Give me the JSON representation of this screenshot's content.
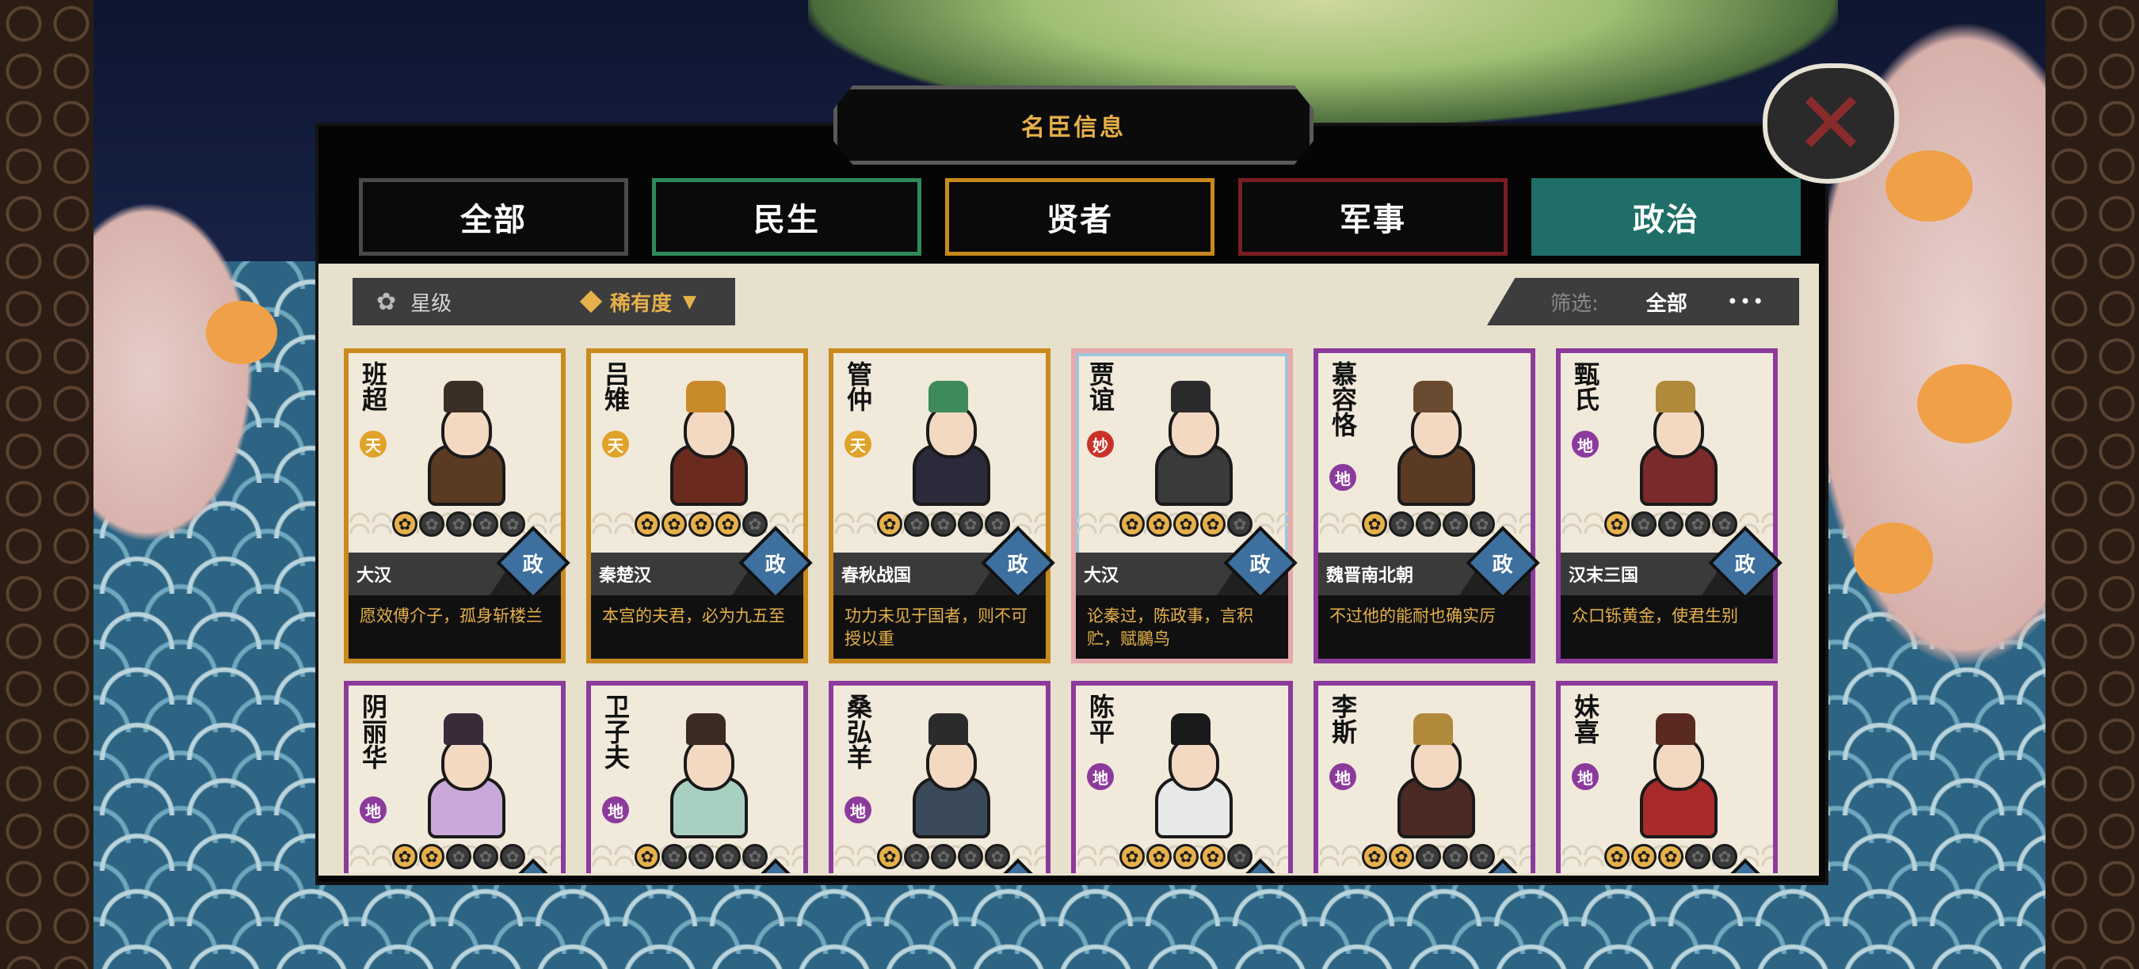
{
  "panel": {
    "title": "名臣信息"
  },
  "tabs": [
    {
      "label": "全部",
      "border": "#4a4a4a",
      "bg": "#0a0a0a",
      "active": false
    },
    {
      "label": "民生",
      "border": "#2f8a5a",
      "bg": "#0a0a0a",
      "active": false
    },
    {
      "label": "贤者",
      "border": "#c88a1e",
      "bg": "#0a0a0a",
      "active": false
    },
    {
      "label": "军事",
      "border": "#7a1e22",
      "bg": "#0a0a0a",
      "active": false
    },
    {
      "label": "政治",
      "border": "#1f6f68",
      "bg": "#1f6f68",
      "active": true
    }
  ],
  "sort": {
    "star_label": "星级",
    "rarity_label": "稀有度"
  },
  "filter": {
    "label": "筛选:",
    "value": "全部",
    "more": "•••"
  },
  "colors": {
    "rank_tian": "#e0a32a",
    "rank_miao": "#c8322a",
    "rank_di": "#8c3a9c",
    "type_zheng": "#3d6f9f",
    "accent_gold": "#e6b04a"
  },
  "cards": [
    {
      "name": "班超",
      "rank": "天",
      "rank_color": "#e0a32a",
      "stars": 1,
      "era": "大汉",
      "type": "政",
      "quote": "愿效傅介子，孤身斩楼兰",
      "frame": "gold",
      "hat": "#3b2e26",
      "robe": "#5a3a22"
    },
    {
      "name": "吕雉",
      "rank": "天",
      "rank_color": "#e0a32a",
      "stars": 4,
      "era": "秦楚汉",
      "type": "政",
      "quote": "本宫的夫君，必为九五至",
      "frame": "gold",
      "hat": "#c98a2a",
      "robe": "#6a2a1e"
    },
    {
      "name": "管仲",
      "rank": "天",
      "rank_color": "#e0a32a",
      "stars": 1,
      "era": "春秋战国",
      "type": "政",
      "quote": "功力未见于国者，则不可授以重",
      "frame": "gold",
      "hat": "#3f8a5a",
      "robe": "#2a2a3a"
    },
    {
      "name": "贾谊",
      "rank": "妙",
      "rank_color": "#c8322a",
      "stars": 4,
      "era": "大汉",
      "type": "政",
      "quote": "论秦过，陈政事，言积贮，赋鵩鸟",
      "frame": "pink",
      "hat": "#2b2b2b",
      "robe": "#3a3a3a"
    },
    {
      "name": "慕容恪",
      "rank": "地",
      "rank_color": "#8c3a9c",
      "stars": 1,
      "era": "魏晋南北朝",
      "type": "政",
      "quote": "不过他的能耐也确实厉",
      "frame": "purple",
      "hat": "#6a4a30",
      "robe": "#5a3a22"
    },
    {
      "name": "甄氏",
      "rank": "地",
      "rank_color": "#8c3a9c",
      "stars": 1,
      "era": "汉末三国",
      "type": "政",
      "quote": "众口铄黄金，使君生别",
      "frame": "purple",
      "hat": "#b08a3a",
      "robe": "#7a2a2a"
    },
    {
      "name": "阴丽华",
      "rank": "地",
      "rank_color": "#8c3a9c",
      "stars": 2,
      "era": "",
      "type": "政",
      "quote": "",
      "frame": "purple",
      "hat": "#3a2a3a",
      "robe": "#c8a8d8"
    },
    {
      "name": "卫子夫",
      "rank": "地",
      "rank_color": "#8c3a9c",
      "stars": 1,
      "era": "",
      "type": "政",
      "quote": "",
      "frame": "purple",
      "hat": "#3a2a22",
      "robe": "#a8d0c0"
    },
    {
      "name": "桑弘羊",
      "rank": "地",
      "rank_color": "#8c3a9c",
      "stars": 1,
      "era": "",
      "type": "政",
      "quote": "",
      "frame": "purple",
      "hat": "#2b2b2b",
      "robe": "#3a4a5a"
    },
    {
      "name": "陈平",
      "rank": "地",
      "rank_color": "#8c3a9c",
      "stars": 4,
      "era": "",
      "type": "政",
      "quote": "",
      "frame": "purple",
      "hat": "#1a1a1a",
      "robe": "#e8e8e8"
    },
    {
      "name": "李斯",
      "rank": "地",
      "rank_color": "#8c3a9c",
      "stars": 2,
      "era": "",
      "type": "政",
      "quote": "",
      "frame": "purple",
      "hat": "#b08a3a",
      "robe": "#4a2a22"
    },
    {
      "name": "妹喜",
      "rank": "地",
      "rank_color": "#8c3a9c",
      "stars": 3,
      "era": "",
      "type": "政",
      "quote": "",
      "frame": "purple",
      "hat": "#5a2a22",
      "robe": "#a82a2a"
    }
  ]
}
